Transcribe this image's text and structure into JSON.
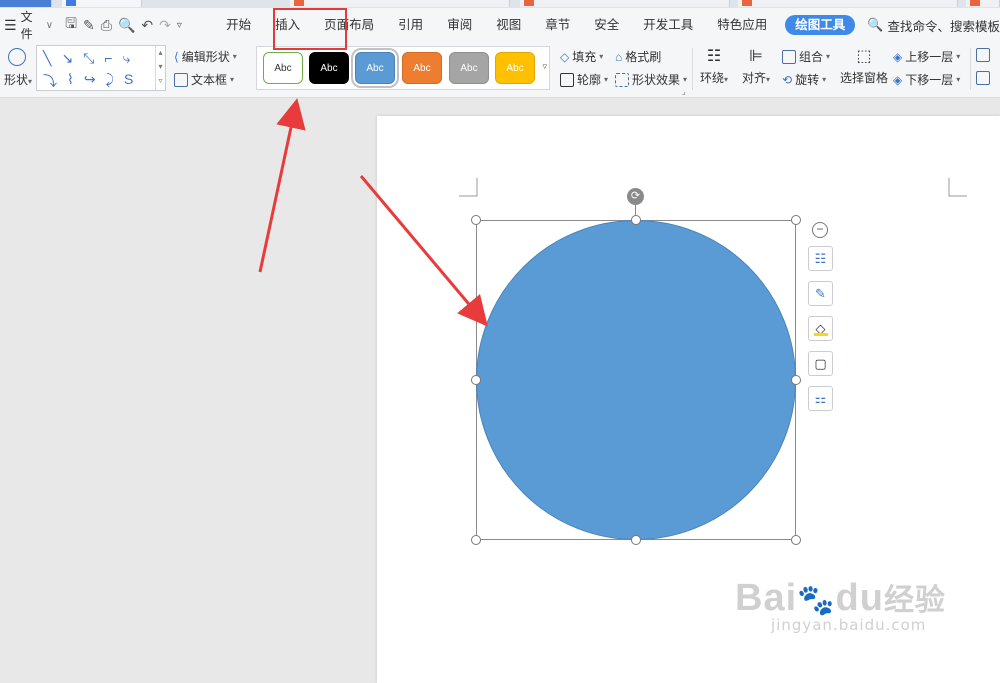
{
  "menu": {
    "file_label": "文件",
    "tabs": [
      "开始",
      "插入",
      "页面布局",
      "引用",
      "审阅",
      "视图",
      "章节",
      "安全",
      "开发工具",
      "特色应用",
      "绘图工具"
    ],
    "active_tab": "绘图工具",
    "search_label": "查找命令、搜索模板"
  },
  "ribbon": {
    "shapes_label": "形状",
    "edit_shape_label": "编辑形状",
    "textbox_label": "文本框",
    "styles": [
      {
        "label": "Abc",
        "bg": "#ffffff",
        "fg": "#333333",
        "border": "#70ad47"
      },
      {
        "label": "Abc",
        "bg": "#000000",
        "fg": "#ffffff",
        "border": "#000000"
      },
      {
        "label": "Abc",
        "bg": "#5b9bd5",
        "fg": "#ffffff",
        "border": "#4a85b9"
      },
      {
        "label": "Abc",
        "bg": "#ed7d31",
        "fg": "#ffffff",
        "border": "#d86a21"
      },
      {
        "label": "Abc",
        "bg": "#a5a5a5",
        "fg": "#ffffff",
        "border": "#8f8f8f"
      },
      {
        "label": "Abc",
        "bg": "#ffc000",
        "fg": "#ffffff",
        "border": "#e0a800"
      }
    ],
    "fill_label": "填充",
    "outline_label": "轮廓",
    "format_painter_label": "格式刷",
    "shape_effects_label": "形状效果",
    "wrap_label": "环绕",
    "align_label": "对齐",
    "group_label": "组合",
    "rotate_label": "旋转",
    "selection_pane_label": "选择窗格",
    "bring_forward_label": "上移一层",
    "send_backward_label": "下移一层"
  },
  "shape": {
    "fill_color": "#5b9bd5",
    "type": "circle"
  },
  "annotations": {
    "highlight_color": "#e53a3a"
  },
  "watermark": {
    "brand": "Bai",
    "brand_cn": "经验",
    "brand_du": "du",
    "url": "jingyan.baidu.com"
  }
}
